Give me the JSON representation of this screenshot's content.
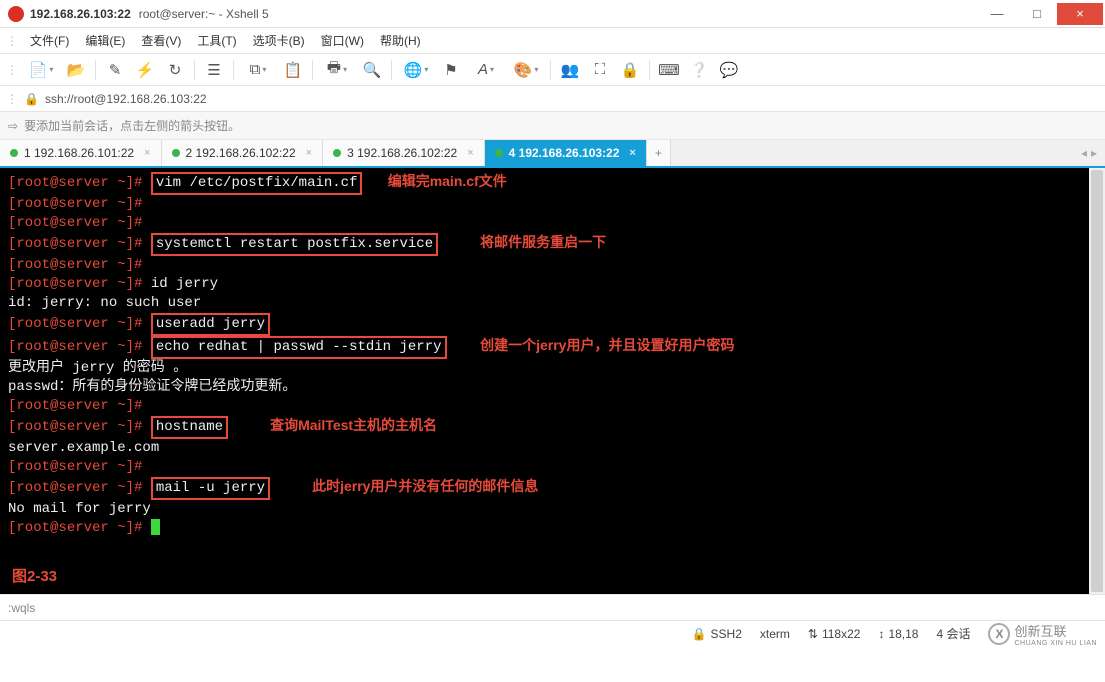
{
  "window": {
    "address": "192.168.26.103:22",
    "title": "root@server:~ - Xshell 5",
    "minimize": "—",
    "maximize": "□",
    "close": "×"
  },
  "menu": {
    "file": "文件(F)",
    "edit": "编辑(E)",
    "view": "查看(V)",
    "tools": "工具(T)",
    "tabs": "选项卡(B)",
    "window": "窗口(W)",
    "help": "帮助(H)"
  },
  "toolbar_icons": {
    "new": "new-doc-icon",
    "open": "open-folder-icon",
    "compose": "compose-icon",
    "save": "save-lightning-icon",
    "reconnect": "reconnect-icon",
    "properties": "properties-icon",
    "copy": "copy-icon",
    "paste": "paste-icon",
    "printer": "printer-icon",
    "search": "search-icon",
    "globe": "globe-icon",
    "flag": "flag-icon",
    "font": "font-icon",
    "palette": "palette-icon",
    "users": "users-icon",
    "fullscreen": "fullscreen-icon",
    "lock": "lock-icon",
    "keyboard": "keyboard-icon",
    "help": "help-icon",
    "chat": "chat-icon"
  },
  "address_bar": {
    "url": "ssh://root@192.168.26.103:22"
  },
  "hint_bar": {
    "text": "要添加当前会话，点击左侧的箭头按钮。"
  },
  "tabs": [
    {
      "label": "1 192.168.26.101:22",
      "active": false
    },
    {
      "label": "2 192.168.26.102:22",
      "active": false
    },
    {
      "label": "3 192.168.26.102:22",
      "active": false
    },
    {
      "label": "4 192.168.26.103:22",
      "active": true
    }
  ],
  "tabs_add": "+",
  "terminal": {
    "prompt_open": "[",
    "prompt_user": "root@server",
    "prompt_rest": " ~]# ",
    "lines": [
      {
        "cmd": "vim /etc/postfix/main.cf",
        "boxed": true,
        "annot": "编辑完main.cf文件",
        "annot_pad": "   "
      },
      {
        "cmd": "",
        "boxed": false
      },
      {
        "cmd": "",
        "boxed": false
      },
      {
        "cmd": "systemctl restart postfix.service",
        "boxed": true,
        "annot": "将邮件服务重启一下",
        "annot_pad": "     "
      },
      {
        "cmd": "",
        "boxed": false
      },
      {
        "cmd": "id jerry",
        "boxed": false
      }
    ],
    "id_output": "id: jerry: no such user",
    "useradd_line": {
      "cmd": "useradd jerry"
    },
    "passwd_line": {
      "cmd": "echo redhat | passwd --stdin jerry",
      "annot": "创建一个jerry用户，并且设置好用户密码",
      "annot_pad": "    "
    },
    "passwd_out1": "更改用户 jerry 的密码 。",
    "passwd_out2": "passwd：所有的身份验证令牌已经成功更新。",
    "empty_prompt1": "",
    "hostname_line": {
      "cmd": "hostname",
      "annot": "查询MailTest主机的主机名",
      "annot_pad": "     "
    },
    "hostname_out": "server.example.com",
    "empty_prompt2": "",
    "mail_line": {
      "cmd": "mail -u jerry",
      "annot": "此时jerry用户并没有任何的邮件信息",
      "annot_pad": "     "
    },
    "mail_out": "No mail for jerry",
    "final_prompt": "",
    "figure_label": "图2-33"
  },
  "cmd_input": ":wqls",
  "status": {
    "ssh": "SSH2",
    "term": "xterm",
    "size": "118x22",
    "pos": "18,18",
    "sessions": "4 会话",
    "size_arrows": "⇅",
    "pos_arrows": "↕",
    "brand_main": "创新互联",
    "brand_sub": "CHUANG XIN HU LIAN"
  }
}
